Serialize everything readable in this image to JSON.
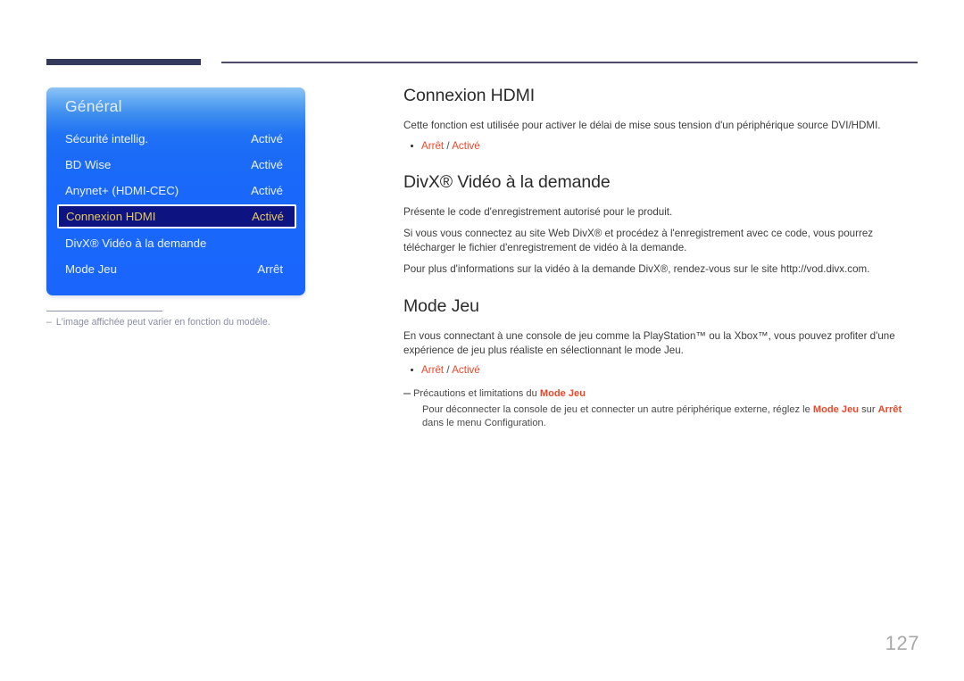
{
  "header": {
    "rule_left_color": "#333a5c",
    "rule_right_color": "#4b4d68"
  },
  "osd_menu": {
    "title": "Général",
    "selected_index": 3,
    "accent_color": "#1a66fd",
    "highlight_bg": "#0d1482",
    "highlight_text_color": "#e8c95a",
    "items": [
      {
        "label": "Sécurité intellig.",
        "value": "Activé"
      },
      {
        "label": "BD Wise",
        "value": "Activé"
      },
      {
        "label": "Anynet+ (HDMI-CEC)",
        "value": "Activé"
      },
      {
        "label": "Connexion HDMI",
        "value": "Activé"
      },
      {
        "label": "DivX® Vidéo à la demande",
        "value": ""
      },
      {
        "label": "Mode Jeu",
        "value": "Arrêt"
      }
    ],
    "footnote": {
      "dash": "–",
      "text": "L'image affichée peut varier en fonction du modèle."
    }
  },
  "content": {
    "sections": [
      {
        "title": "Connexion HDMI",
        "paragraphs": [
          "Cette fonction est utilisée pour activer le délai de mise sous tension d'un périphérique source DVI/HDMI."
        ],
        "bullet": {
          "option_off": "Arrêt",
          "separator": "/",
          "option_on": "Activé"
        }
      },
      {
        "title": "DivX® Vidéo à la demande",
        "paragraphs": [
          "Présente le code d'enregistrement autorisé pour le produit.",
          "Si vous vous connectez au site Web DivX® et procédez à l'enregistrement avec ce code, vous pourrez télécharger le fichier d'enregistrement de vidéo à la demande.",
          "Pour plus d'informations sur la vidéo à la demande DivX®, rendez-vous sur le site http://vod.divx.com."
        ]
      },
      {
        "title": "Mode Jeu",
        "paragraphs": [
          "En vous connectant à une console de jeu comme la PlayStation™ ou la Xbox™, vous pouvez profiter d'une expérience de jeu plus réaliste en sélectionnant le mode Jeu."
        ],
        "bullet": {
          "option_off": "Arrêt",
          "separator": "/",
          "option_on": "Activé"
        },
        "note": {
          "head_prefix": "Précautions et limitations du ",
          "head_highlight": "Mode Jeu",
          "body_part1": "Pour déconnecter la console de jeu et connecter un autre périphérique externe, réglez le ",
          "body_hl1": "Mode Jeu",
          "body_part2": " sur ",
          "body_hl2": "Arrêt",
          "body_part3": " dans le menu Configuration."
        }
      }
    ]
  },
  "footer": {
    "page_number": "127"
  }
}
